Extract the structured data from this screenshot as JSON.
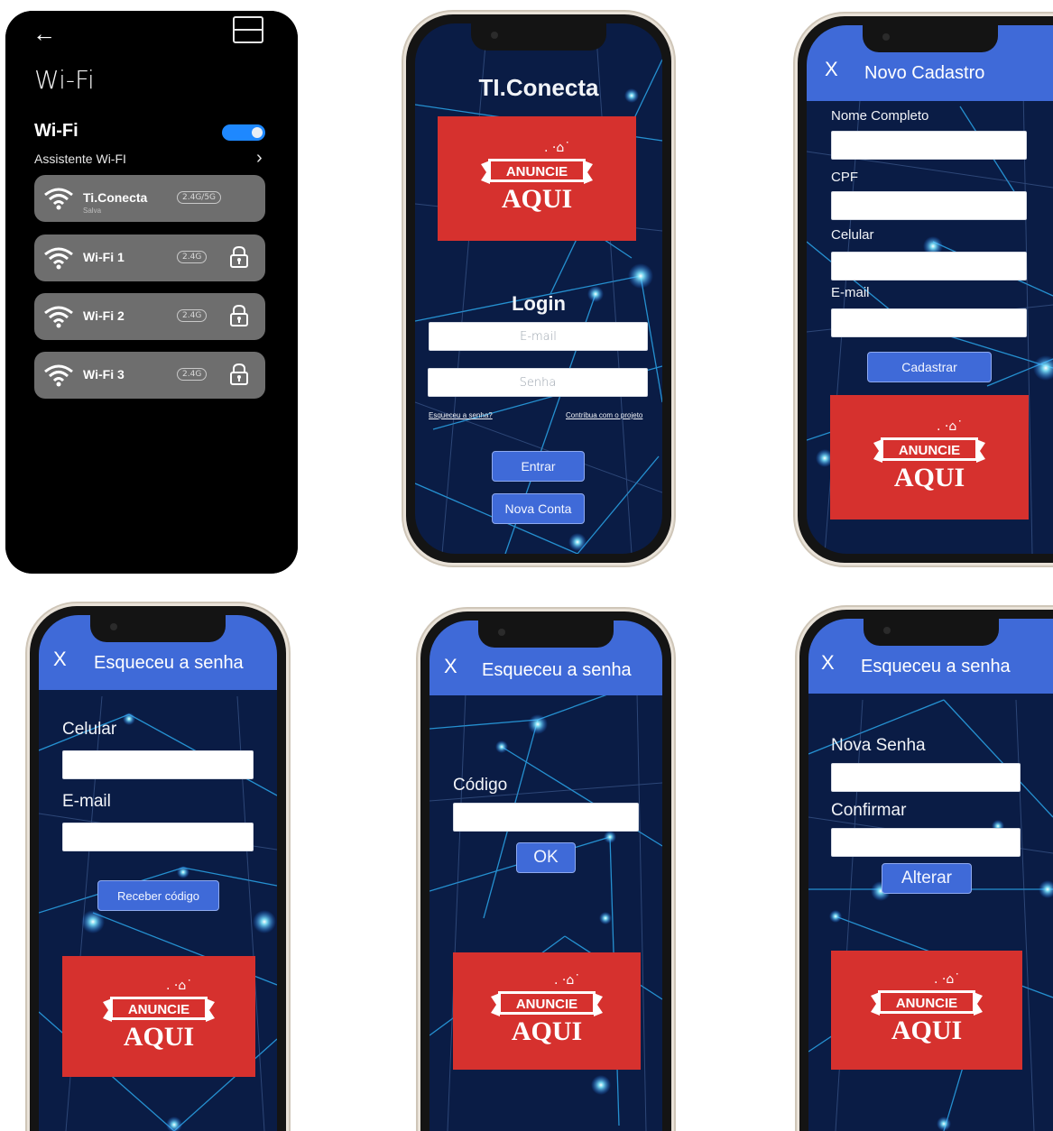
{
  "wifi_screen": {
    "title": "Wi-Fi",
    "section_title": "Wi-Fi",
    "toggle_on": true,
    "assistant_label": "Assistente Wi-FI",
    "networks": [
      {
        "name": "Ti.Conecta",
        "badge": "2.4G/5G",
        "sub": "Salva",
        "locked": false
      },
      {
        "name": "Wi-Fi 1",
        "badge": "2.4G",
        "sub": "",
        "locked": true
      },
      {
        "name": "Wi-Fi 2",
        "badge": "2.4G",
        "sub": "",
        "locked": true
      },
      {
        "name": "Wi-Fi 3",
        "badge": "2.4G",
        "sub": "",
        "locked": true
      }
    ]
  },
  "login_screen": {
    "app_title": "TI.Conecta",
    "login_title": "Login",
    "email_placeholder": "E-mail",
    "password_placeholder": "Senha",
    "forgot_link": "Esqueceu a senha?",
    "contribute_link": "Contribua com o projeto",
    "enter_label": "Entrar",
    "new_account_label": "Nova Conta"
  },
  "signup_screen": {
    "close_label": "X",
    "title": "Novo Cadastro",
    "fields": [
      "Nome Completo",
      "CPF",
      "Celular",
      "E-mail"
    ],
    "submit_label": "Cadastrar"
  },
  "forgot_step1": {
    "close_label": "X",
    "title": "Esqueceu a senha",
    "phone_label": "Celular",
    "email_label": "E-mail",
    "submit_label": "Receber código"
  },
  "forgot_step2": {
    "close_label": "X",
    "title": "Esqueceu a senha",
    "code_label": "Código",
    "submit_label": "OK"
  },
  "forgot_step3": {
    "close_label": "X",
    "title": "Esqueceu a senha",
    "new_password_label": "Nova Senha",
    "confirm_label": "Confirmar",
    "submit_label": "Alterar"
  },
  "ad": {
    "line1": "ANUNCIE",
    "line2": "AQUI"
  },
  "colors": {
    "accent": "#3f6ad8",
    "ad_red": "#d6312e",
    "screen_bg": "#0a1c45",
    "toggle": "#1e88ff"
  }
}
